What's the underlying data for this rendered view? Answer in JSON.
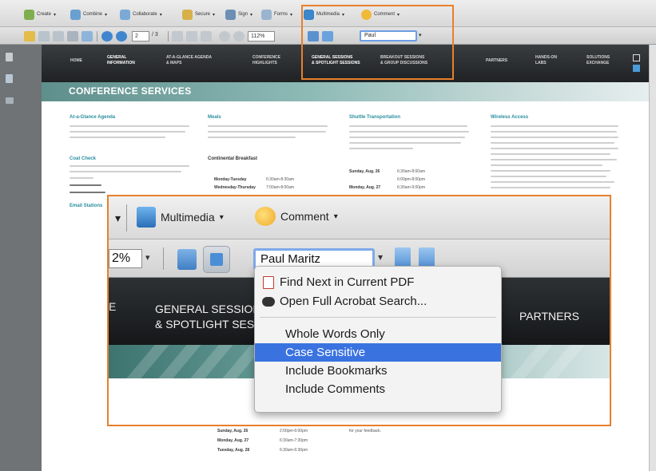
{
  "toolbar": {
    "row1": [
      {
        "label": "Create",
        "icon": "create-icon",
        "color": "#7fae4e"
      },
      {
        "label": "Combine",
        "icon": "combine-icon",
        "color": "#6aa0d0"
      },
      {
        "label": "Collaborate",
        "icon": "collaborate-icon",
        "color": "#7aa9d6"
      },
      {
        "label": "Secure",
        "icon": "lock-icon",
        "color": "#d8b04a"
      },
      {
        "label": "Sign",
        "icon": "sign-pen-icon",
        "color": "#6d8fb5"
      },
      {
        "label": "Forms",
        "icon": "forms-icon",
        "color": "#9ab4cf"
      },
      {
        "label": "Multimedia",
        "icon": "multimedia-icon",
        "color": "#3c86c9"
      },
      {
        "label": "Comment",
        "icon": "comment-bubble-icon",
        "color": "#f0b93a"
      }
    ],
    "page_current": "2",
    "page_total": "/ 3",
    "zoom_value": "112%",
    "search_value": "Paul"
  },
  "document": {
    "nav": [
      "HOME",
      "GENERAL\nINFORMATION",
      "AT-A-GLANCE AGENDA\n& MAPS",
      "CONFERENCE\nHIGHLIGHTS",
      "GENERAL SESSIONS\n& SPOTLIGHT SESSIONS",
      "BREAKOUT SESSIONS\n& GROUP DISCUSSIONS",
      "PARTNERS",
      "HANDS-ON\nLABS",
      "SOLUTIONS\nEXCHANGE"
    ],
    "section_title": "CONFERENCE SERVICES",
    "columns": [
      {
        "heading": "At-a-Glance Agenda",
        "subheading": "Coat Check",
        "sub2": "Email Stations"
      },
      {
        "heading": "Meals",
        "subheading": "Continental Breakfast",
        "rows": [
          [
            "Monday-Tuesday",
            "6:30am-8:30am"
          ],
          [
            "Wednesday-Thursday",
            "7:00am-8:00am"
          ]
        ]
      },
      {
        "heading": "Shuttle Transportation",
        "rows": [
          [
            "Sunday, Aug. 26",
            "6:30am-8:00am"
          ],
          [
            "",
            "6:00pm-8:00pm"
          ],
          [
            "Monday, Aug. 27",
            "6:30am-9:00pm"
          ]
        ]
      },
      {
        "heading": "Wireless Access"
      }
    ],
    "lower_rows": [
      [
        "Sunday, Aug. 26",
        "2:00pm-6:00pm"
      ],
      [
        "Monday, Aug. 27",
        "6:30am-7:30pm"
      ],
      [
        "Tuesday, Aug. 28",
        "6:30am-6:30pm"
      ]
    ],
    "lower_right_text": "for your feedback."
  },
  "zoom": {
    "menu_multimedia": "Multimedia",
    "menu_comment": "Comment",
    "zoom_partial": "2%",
    "search_value": "Paul Maritz",
    "nav_general": "GENERAL SESSIONS",
    "nav_spotlight": "& SPOTLIGHT SESSIONS",
    "nav_partners": "PARTNERS",
    "left_fragment": "E"
  },
  "search_menu": {
    "items": [
      {
        "label": "Find Next in Current PDF",
        "icon": "pdf-icon"
      },
      {
        "label": "Open Full Acrobat Search...",
        "icon": "binoculars-icon"
      }
    ],
    "options": [
      {
        "label": "Whole Words Only",
        "selected": false
      },
      {
        "label": "Case Sensitive",
        "selected": true
      },
      {
        "label": "Include Bookmarks",
        "selected": false
      },
      {
        "label": "Include Comments",
        "selected": false
      }
    ]
  },
  "colors": {
    "highlight_border": "#e8802c",
    "menu_selection": "#3a73e0",
    "teal_heading": "#2a8ea0"
  }
}
